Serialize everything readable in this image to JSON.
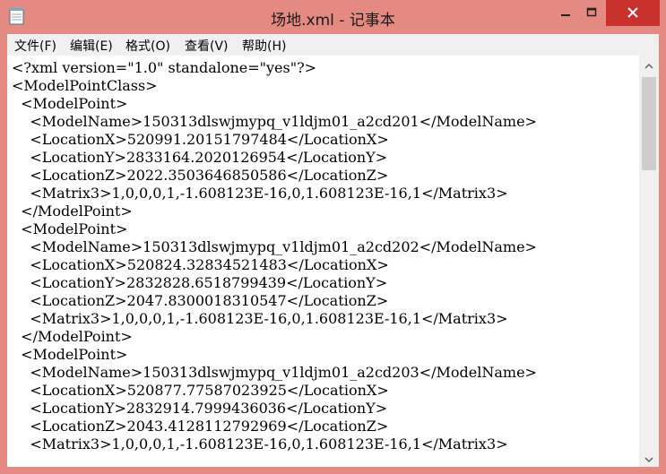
{
  "window": {
    "title": "场地.xml - 记事本"
  },
  "menu": [
    "文件(F)",
    "编辑(E)",
    "格式(O)",
    "查看(V)",
    "帮助(H)"
  ],
  "lines": [
    "<?xml version=\"1.0\" standalone=\"yes\"?>",
    "<ModelPointClass>",
    "  <ModelPoint>",
    "    <ModelName>150313dlswjmypq_v1ldjm01_a2cd201</ModelName>",
    "    <LocationX>520991.20151797484</LocationX>",
    "    <LocationY>2833164.2020126954</LocationY>",
    "    <LocationZ>2022.3503646850586</LocationZ>",
    "    <Matrix3>1,0,0,0,1,-1.608123E-16,0,1.608123E-16,1</Matrix3>",
    "  </ModelPoint>",
    "  <ModelPoint>",
    "    <ModelName>150313dlswjmypq_v1ldjm01_a2cd202</ModelName>",
    "    <LocationX>520824.32834521483</LocationX>",
    "    <LocationY>2832828.6518799439</LocationY>",
    "    <LocationZ>2047.8300018310547</LocationZ>",
    "    <Matrix3>1,0,0,0,1,-1.608123E-16,0,1.608123E-16,1</Matrix3>",
    "  </ModelPoint>",
    "  <ModelPoint>",
    "    <ModelName>150313dlswjmypq_v1ldjm01_a2cd203</ModelName>",
    "    <LocationX>520877.77587023925</LocationX>",
    "    <LocationY>2832914.7999436036</LocationY>",
    "    <LocationZ>2043.4128112792969</LocationZ>",
    "    <Matrix3>1,0,0,0,1,-1.608123E-16,0,1.608123E-16,1</Matrix3>"
  ],
  "icons": {
    "app": "notepad-icon",
    "minimize": "minimize-icon",
    "maximize": "maximize-icon",
    "close": "close-icon",
    "scroll_up": "arrow-up-icon",
    "scroll_down": "arrow-down-icon"
  },
  "colors": {
    "titlebar": "#e58a82",
    "close_button": "#c7302b",
    "menubar": "#f0f0f0",
    "editor": "#ffffff"
  }
}
